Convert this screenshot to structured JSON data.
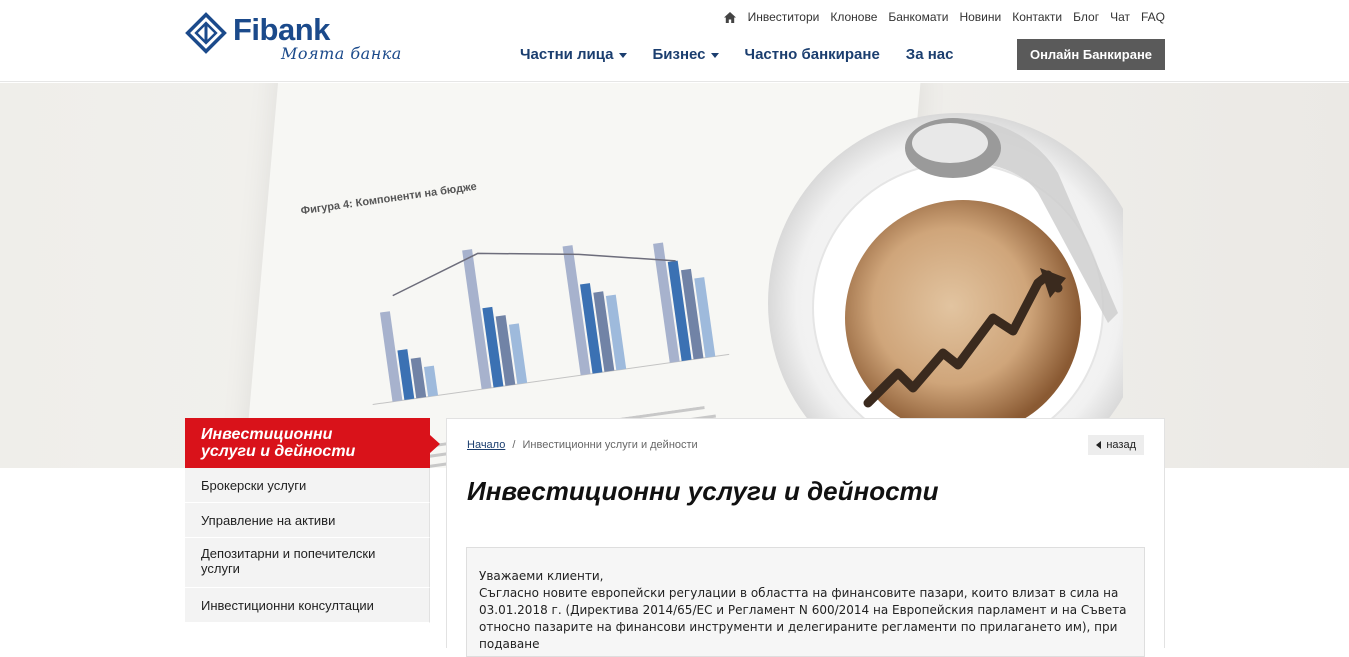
{
  "logo": {
    "brand": "Fibank",
    "slogan": "Моята банка"
  },
  "topnav": {
    "items": [
      "Инвеститори",
      "Клонове",
      "Банкомати",
      "Новини",
      "Контакти",
      "Блог",
      "Чат",
      "FAQ"
    ]
  },
  "mainnav": {
    "items": [
      {
        "label": "Частни лица",
        "dropdown": true
      },
      {
        "label": "Бизнес",
        "dropdown": true
      },
      {
        "label": "Частно банкиране",
        "dropdown": false
      },
      {
        "label": "За нас",
        "dropdown": false
      }
    ],
    "online_banking": "Онлайн Банкиране"
  },
  "hero": {
    "paper_title": "Фигура 4: Компоненти на бюдже"
  },
  "sidebar": {
    "title_line1": "Инвестиционни",
    "title_line2": "услуги и дейности",
    "links": [
      "Брокерски услуги",
      "Управление на активи",
      "Депозитарни и попечителски услуги",
      "Инвестиционни консултации"
    ]
  },
  "content": {
    "breadcrumb_home": "Начало",
    "breadcrumb_sep": "/",
    "breadcrumb_current": "Инвестиционни услуги и дейности",
    "back_label": "назад",
    "title": "Инвестиционни услуги и дейности",
    "notice_lines": [
      "Уважаеми клиенти,",
      "Съгласно новите европейски регулации в областта на финансовите пазари, които влизат в сила на",
      "03.01.2018 г. (Директива 2014/65/ЕС и Регламент N 600/2014 на Европейския парламент и на Съвета",
      "относно пазарите на финансови инструменти и делегираните регламенти по прилагането им), при подаване"
    ]
  },
  "colors": {
    "brand_blue": "#1b4a8b",
    "nav_blue": "#1b3e6f",
    "accent_red": "#d9121a",
    "online_button": "#5a5a5a"
  }
}
